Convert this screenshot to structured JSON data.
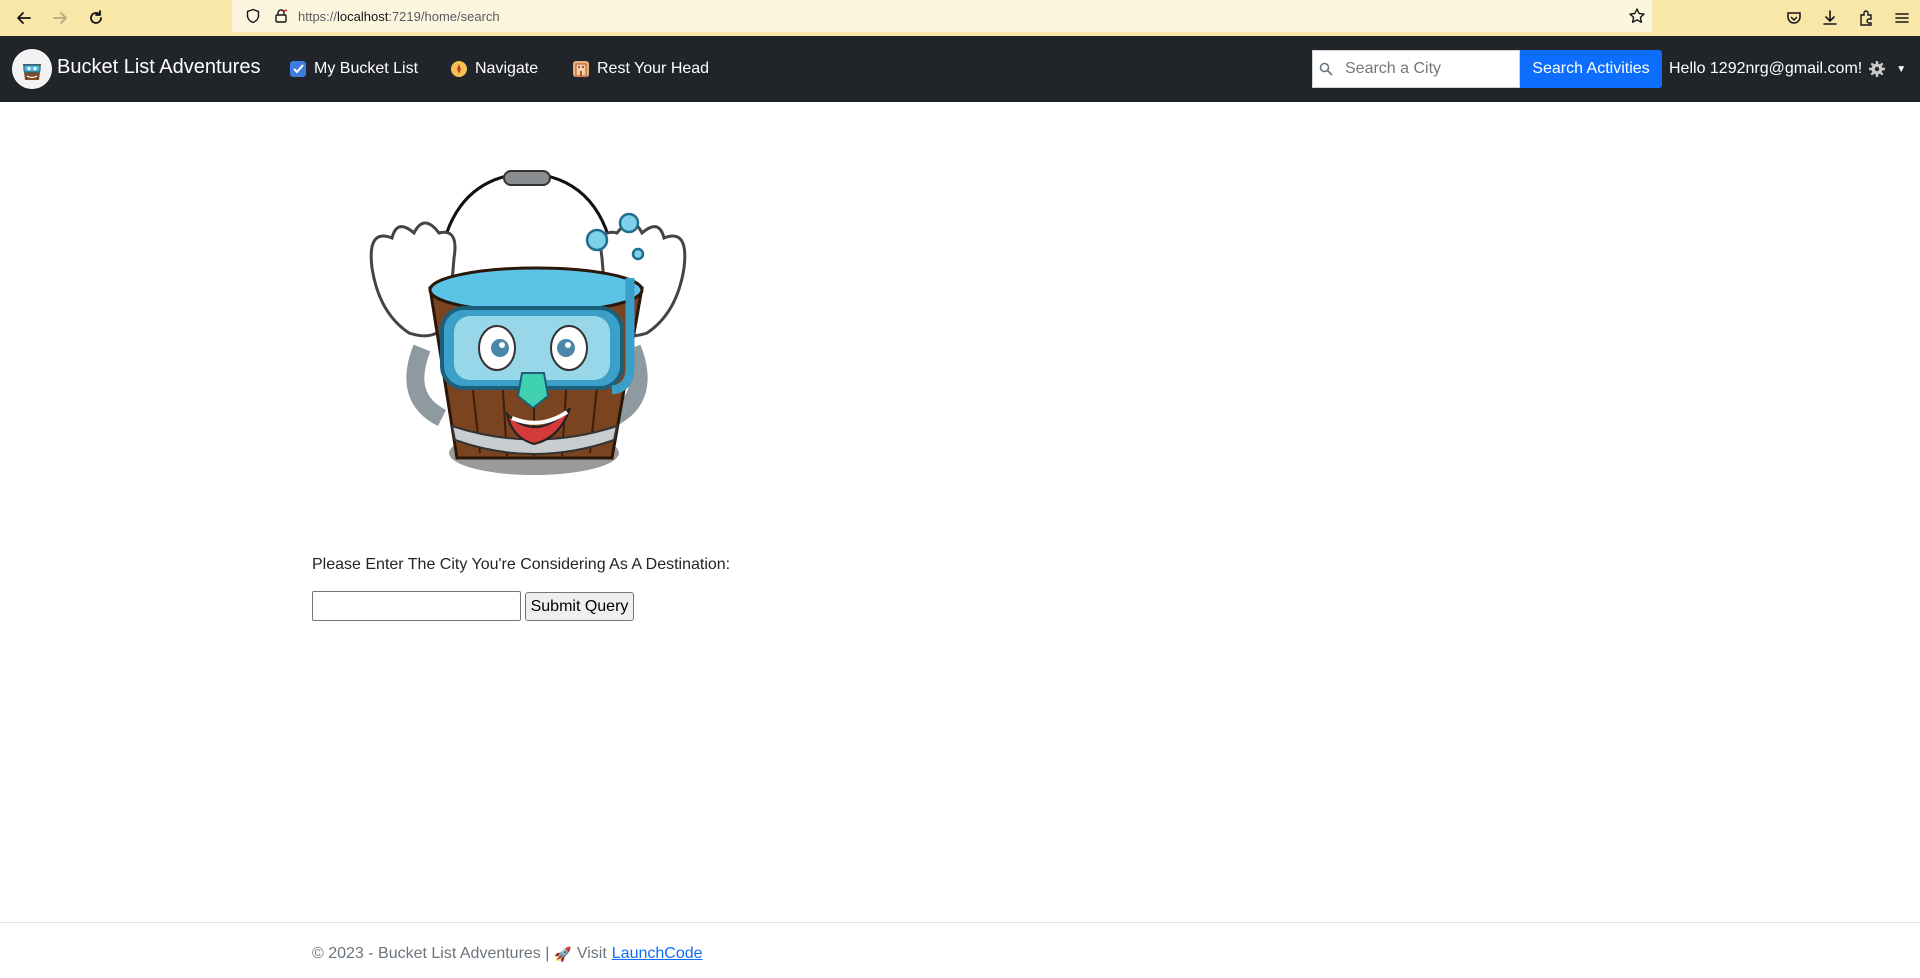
{
  "browser": {
    "url_prefix": "https://",
    "url_host": "localhost",
    "url_rest": ":7219/home/search",
    "icons": [
      "back-icon",
      "forward-icon",
      "reload-icon",
      "shield-icon",
      "lock-icon",
      "star-icon",
      "pocket-icon",
      "download-icon",
      "extensions-icon",
      "menu-icon"
    ]
  },
  "navbar": {
    "brand": "Bucket List Adventures",
    "links": [
      {
        "label": "My Bucket List",
        "icon": "checklist-icon"
      },
      {
        "label": "Navigate",
        "icon": "compass-icon"
      },
      {
        "label": "Rest Your Head",
        "icon": "hotel-icon"
      }
    ],
    "search_placeholder": "Search a City",
    "search_button": "Search Activities",
    "greeting": "Hello 1292nrg@gmail.com!",
    "colors": {
      "bg": "#212529",
      "primary": "#0d6efd"
    }
  },
  "main": {
    "prompt": "Please Enter The City You're Considering As A Destination:",
    "city_value": "",
    "submit_label": "Submit Query"
  },
  "footer": {
    "text": "© 2023 - Bucket List Adventures |",
    "visit": "Visit",
    "link": "LaunchCode"
  }
}
